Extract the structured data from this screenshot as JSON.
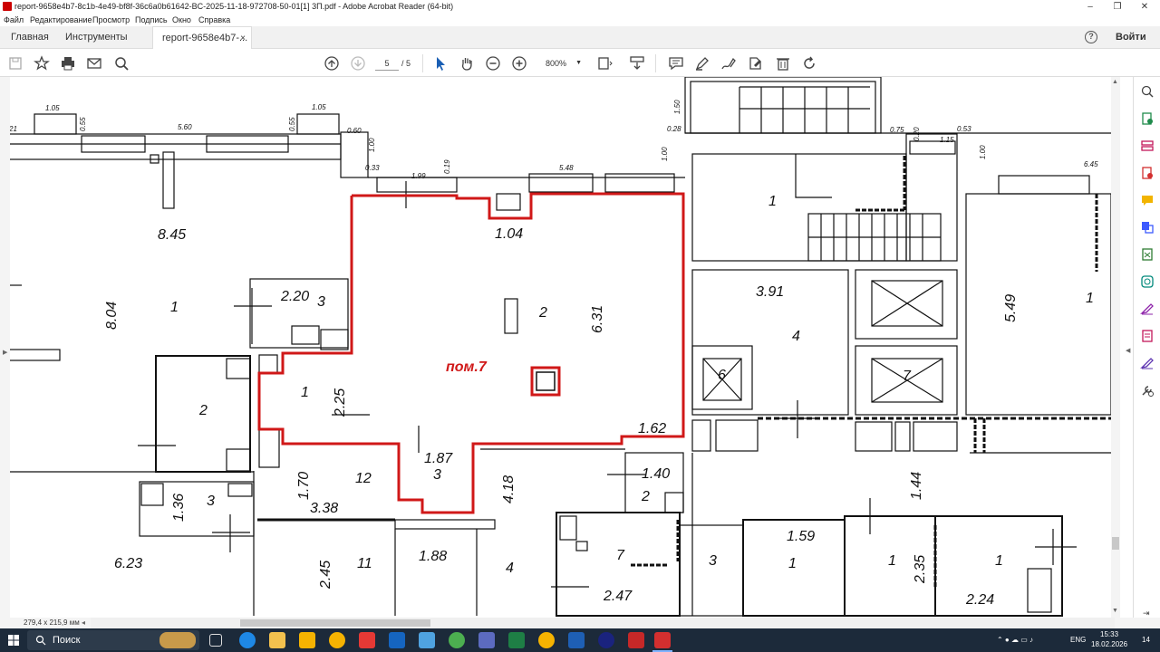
{
  "window": {
    "title": "report-9658e4b7-8c1b-4e49-bf8f-36c6a0b61642-BC-2025-11-18-972708-50-01[1] 3Π.pdf - Adobe Acrobat Reader (64-bit)",
    "minimize": "–",
    "maximize": "❐",
    "close": "✕"
  },
  "menu": [
    "Файл",
    "Редактирование",
    "Просмотр",
    "Подпись",
    "Окно",
    "Справка"
  ],
  "tabs": {
    "home": "Главная",
    "tools": "Инструменты",
    "document": "report-9658e4b7-...",
    "close": "×",
    "help": "?",
    "sign_in": "Войти"
  },
  "toolbar": {
    "page_current": "5",
    "page_total": "/ 5",
    "zoom": "800%"
  },
  "status": {
    "page_size": "279,4 x 215,9 мм"
  },
  "taskbar": {
    "search_placeholder": "Поиск",
    "lang": "ENG",
    "time": "15:33",
    "date": "18.02.2026",
    "notifications": "14"
  },
  "plan": {
    "dimensions": [
      "1.05",
      "1.05",
      "5.60",
      "0.55",
      "0.55",
      "0.60",
      "1.00",
      "1.50",
      "0.28",
      "0.33",
      "1.99",
      "0.19",
      "5.48",
      "1.00",
      "0.75",
      "0.20",
      "1.15",
      "0.53",
      "1.00",
      "6.45",
      "21"
    ],
    "labels": {
      "area_845": "8.45",
      "area_804": "8.04",
      "room1_left": "1",
      "area_220": "2.20",
      "room3_a": "3",
      "room2_left": "2",
      "room1_red": "1",
      "area_225": "2.25",
      "room_name": "пом.7",
      "area_104": "1.04",
      "room2_red": "2",
      "area_631": "6.31",
      "area_162": "1.62",
      "area_187": "1.87",
      "room3_red": "3",
      "area_170": "1.70",
      "room12": "12",
      "area_338": "3.38",
      "area_136": "1.36",
      "room3_b": "3",
      "area_623": "6.23",
      "area_245": "2.45",
      "room11": "11",
      "area_188": "1.88",
      "room4_a": "4",
      "area_418": "4.18",
      "area_140": "1.40",
      "room2_mid": "2",
      "room7_low": "7",
      "area_247": "2.47",
      "room3_c": "3",
      "area_159": "1.59",
      "room1_c": "1",
      "room1_d": "1",
      "area_235": "2.35",
      "room1_e": "1",
      "area_224": "2.24",
      "area_144": "1.44",
      "room1_stair": "1",
      "area_391": "3.91",
      "room4_b": "4",
      "lift6": "6",
      "lift7": "7",
      "area_549": "5.49",
      "room1_right": "1"
    }
  }
}
